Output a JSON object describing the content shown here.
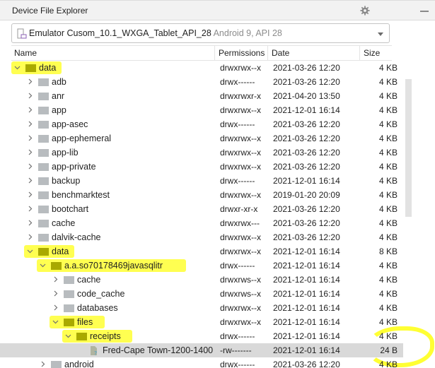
{
  "window": {
    "title": "Device File Explorer",
    "icons": [
      "gear-icon",
      "minimize-icon"
    ]
  },
  "device_selector": {
    "device_name": "Emulator Cusom_10.1_WXGA_Tablet_API_28",
    "device_detail": "Android 9, API 28",
    "icon": "device-icon"
  },
  "table": {
    "columns": [
      "Name",
      "Permissions",
      "Date",
      "Size"
    ],
    "rows": [
      {
        "name": "data",
        "level": 0,
        "type": "folder",
        "expanded": true,
        "highlighted": true,
        "permissions": "drwxrwx--x",
        "date": "2021-03-26 12:20",
        "size": "4 KB"
      },
      {
        "name": "adb",
        "level": 1,
        "type": "folder",
        "expanded": false,
        "permissions": "drwx------",
        "date": "2021-03-26 12:20",
        "size": "4 KB"
      },
      {
        "name": "anr",
        "level": 1,
        "type": "folder",
        "expanded": false,
        "permissions": "drwxrwxr-x",
        "date": "2021-04-20 13:50",
        "size": "4 KB"
      },
      {
        "name": "app",
        "level": 1,
        "type": "folder",
        "expanded": false,
        "permissions": "drwxrwx--x",
        "date": "2021-12-01 16:14",
        "size": "4 KB"
      },
      {
        "name": "app-asec",
        "level": 1,
        "type": "folder",
        "expanded": false,
        "permissions": "drwx------",
        "date": "2021-03-26 12:20",
        "size": "4 KB"
      },
      {
        "name": "app-ephemeral",
        "level": 1,
        "type": "folder",
        "expanded": false,
        "permissions": "drwxrwx--x",
        "date": "2021-03-26 12:20",
        "size": "4 KB"
      },
      {
        "name": "app-lib",
        "level": 1,
        "type": "folder",
        "expanded": false,
        "permissions": "drwxrwx--x",
        "date": "2021-03-26 12:20",
        "size": "4 KB"
      },
      {
        "name": "app-private",
        "level": 1,
        "type": "folder",
        "expanded": false,
        "permissions": "drwxrwx--x",
        "date": "2021-03-26 12:20",
        "size": "4 KB"
      },
      {
        "name": "backup",
        "level": 1,
        "type": "folder",
        "expanded": false,
        "permissions": "drwx------",
        "date": "2021-12-01 16:14",
        "size": "4 KB"
      },
      {
        "name": "benchmarktest",
        "level": 1,
        "type": "folder",
        "expanded": false,
        "permissions": "drwxrwx--x",
        "date": "2019-01-20 20:09",
        "size": "4 KB"
      },
      {
        "name": "bootchart",
        "level": 1,
        "type": "folder",
        "expanded": false,
        "permissions": "drwxr-xr-x",
        "date": "2021-03-26 12:20",
        "size": "4 KB"
      },
      {
        "name": "cache",
        "level": 1,
        "type": "folder",
        "expanded": false,
        "permissions": "drwxrwx---",
        "date": "2021-03-26 12:20",
        "size": "4 KB"
      },
      {
        "name": "dalvik-cache",
        "level": 1,
        "type": "folder",
        "expanded": false,
        "permissions": "drwxrwx--x",
        "date": "2021-03-26 12:20",
        "size": "4 KB"
      },
      {
        "name": "data",
        "level": 1,
        "type": "folder",
        "expanded": true,
        "highlighted": true,
        "permissions": "drwxrwx--x",
        "date": "2021-12-01 16:14",
        "size": "8 KB"
      },
      {
        "name": "a.a.so70178469javasqlitr",
        "level": 2,
        "type": "folder",
        "expanded": true,
        "highlighted": true,
        "permissions": "drwx------",
        "date": "2021-12-01 16:14",
        "size": "4 KB"
      },
      {
        "name": "cache",
        "level": 3,
        "type": "folder",
        "expanded": false,
        "permissions": "drwxrws--x",
        "date": "2021-12-01 16:14",
        "size": "4 KB"
      },
      {
        "name": "code_cache",
        "level": 3,
        "type": "folder",
        "expanded": false,
        "permissions": "drwxrws--x",
        "date": "2021-12-01 16:14",
        "size": "4 KB"
      },
      {
        "name": "databases",
        "level": 3,
        "type": "folder",
        "expanded": false,
        "permissions": "drwxrwx--x",
        "date": "2021-12-01 16:14",
        "size": "4 KB"
      },
      {
        "name": "files",
        "level": 3,
        "type": "folder",
        "expanded": true,
        "highlighted": true,
        "permissions": "drwxrwx--x",
        "date": "2021-12-01 16:14",
        "size": "4 KB"
      },
      {
        "name": "receipts",
        "level": 4,
        "type": "folder",
        "expanded": true,
        "highlighted": true,
        "permissions": "drwx------",
        "date": "2021-12-01 16:14",
        "size": "4 KB"
      },
      {
        "name": "Fred-Cape Town-1200-1400",
        "level": 5,
        "type": "file",
        "selected": true,
        "highlighted": true,
        "permissions": "-rw-------",
        "date": "2021-12-01 16:14",
        "size": "24 B"
      },
      {
        "name": "android",
        "level": 2,
        "type": "folder",
        "expanded": false,
        "permissions": "drwx------",
        "date": "2021-03-26 12:20",
        "size": "4 KB"
      }
    ]
  },
  "colors": {
    "highlight": "#ffff33",
    "selected_row": "#d9d9d9",
    "folder": "#b8bcbf"
  }
}
